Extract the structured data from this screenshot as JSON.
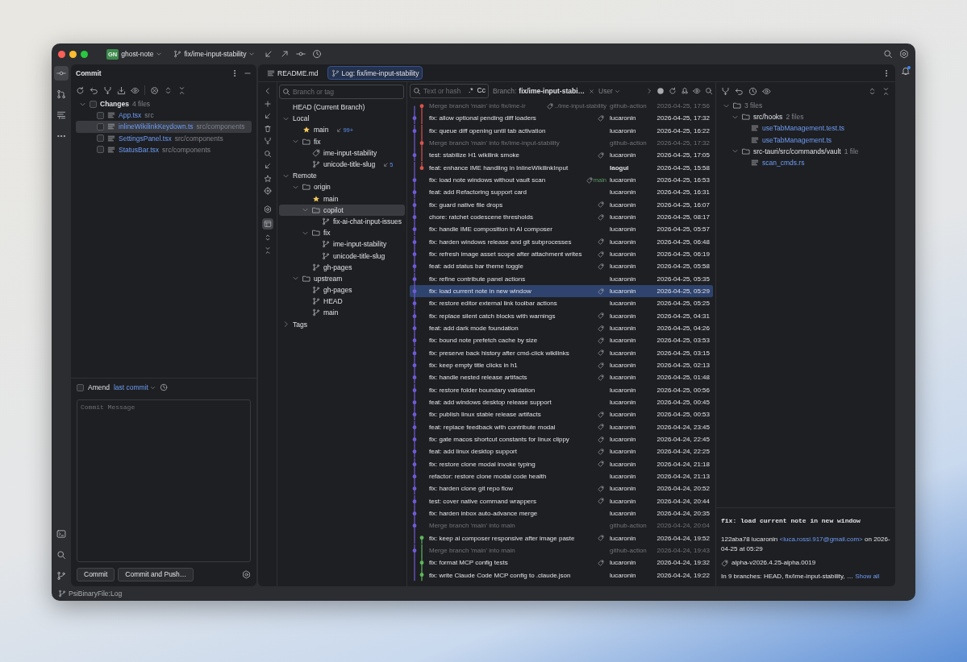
{
  "title_bar": {
    "project_badge": "GN",
    "project": "ghost-note",
    "branch": "fix/ime-input-stability"
  },
  "commit_panel": {
    "title": "Commit",
    "changes": {
      "label": "Changes",
      "count": "4 files",
      "checked": false,
      "expanded": true,
      "files": [
        {
          "name": "App.tsx",
          "path": "src",
          "checked": false,
          "selected": false
        },
        {
          "name": "inlineWikilinkKeydown.ts",
          "path": "src/components",
          "checked": false,
          "selected": true
        },
        {
          "name": "SettingsPanel.tsx",
          "path": "src/components",
          "checked": false,
          "selected": false
        },
        {
          "name": "StatusBar.tsx",
          "path": "src/components",
          "checked": false,
          "selected": false
        }
      ]
    },
    "amend": {
      "label": "Amend",
      "link": "last commit",
      "checked": false
    },
    "message": {
      "placeholder": "Commit Message"
    },
    "buttons": [
      "Commit",
      "Commit and Push…"
    ]
  },
  "editor_tabs": [
    {
      "label": "README.md",
      "kind": "file",
      "selected": false
    },
    {
      "label": "Log: fix/ime-input-stability",
      "kind": "log",
      "selected": true
    }
  ],
  "branches": {
    "search": {
      "placeholder": "Branch or tag"
    },
    "tree": [
      {
        "label": "HEAD (Current Branch)",
        "selected": false
      },
      {
        "label": "Local",
        "expanded": true,
        "selected": false,
        "children": [
          {
            "label": "main",
            "kind": "favorite",
            "badge": "99+",
            "selected": false
          },
          {
            "label": "fix",
            "kind": "folder",
            "expanded": true,
            "selected": false,
            "children": [
              {
                "label": "ime-input-stability",
                "kind": "current",
                "selected": false
              },
              {
                "label": "unicode-title-slug",
                "kind": "branch",
                "badge": "5",
                "selected": false
              }
            ]
          }
        ]
      },
      {
        "label": "Remote",
        "expanded": true,
        "selected": false,
        "children": [
          {
            "label": "origin",
            "kind": "folder",
            "expanded": true,
            "selected": false,
            "children": [
              {
                "label": "main",
                "kind": "favorite",
                "selected": false
              },
              {
                "label": "copilot",
                "kind": "folder",
                "expanded": true,
                "selected": true,
                "children": [
                  {
                    "label": "fix-ai-chat-input-issues",
                    "kind": "branch",
                    "selected": false
                  }
                ]
              },
              {
                "label": "fix",
                "kind": "folder",
                "expanded": true,
                "selected": false,
                "children": [
                  {
                    "label": "ime-input-stability",
                    "kind": "branch",
                    "selected": false
                  },
                  {
                    "label": "unicode-title-slug",
                    "kind": "branch",
                    "selected": false
                  }
                ]
              },
              {
                "label": "gh-pages",
                "kind": "branch",
                "selected": false
              }
            ]
          },
          {
            "label": "upstream",
            "kind": "folder",
            "expanded": true,
            "selected": false,
            "children": [
              {
                "label": "gh-pages",
                "kind": "branch",
                "selected": false
              },
              {
                "label": "HEAD",
                "kind": "branch",
                "selected": false
              },
              {
                "label": "main",
                "kind": "branch",
                "selected": false
              }
            ]
          }
        ]
      },
      {
        "label": "Tags",
        "expanded": false,
        "selected": false
      }
    ]
  },
  "log_filter": {
    "placeholder": "Text or hash",
    "regex": ".*",
    "match_case": "Cc",
    "branch_label": "Branch:",
    "branch_value": "fix/ime-input-stabi…",
    "user": "User"
  },
  "commits": [
    {
      "subject": "Merge branch 'main' into fix/ime-ir",
      "kind": "merge",
      "ref": "../ime-input-stability",
      "tagged": false,
      "author": "github-action",
      "date": "2026-04-25, 17:56",
      "color": "#d9534f",
      "selected": false
    },
    {
      "subject": "fix: allow optional pending diff loaders",
      "kind": "commit",
      "tagged": true,
      "author": "lucaronin",
      "date": "2026-04-25, 17:32",
      "color": "#6f5bd6",
      "selected": false
    },
    {
      "subject": "fix: queue diff opening until tab activation",
      "kind": "commit",
      "tagged": false,
      "author": "lucaronin",
      "date": "2026-04-25, 16:22",
      "color": "#6f5bd6",
      "selected": false
    },
    {
      "subject": "Merge branch 'main' into fix/ime-input-stability",
      "kind": "merge",
      "tagged": false,
      "author": "github-action",
      "date": "2026-04-25, 17:32",
      "color": "#d9534f",
      "selected": false
    },
    {
      "subject": "test: stabilize H1 wikilink smoke",
      "kind": "commit",
      "tagged": true,
      "author": "lucaronin",
      "date": "2026-04-25, 17:05",
      "color": "#6f5bd6",
      "selected": false
    },
    {
      "subject": "feat: enhance IME handling in InlineWikilinkInput",
      "kind": "commit",
      "tagged": false,
      "author": "laogui",
      "author_bold": true,
      "date": "2026-04-25, 15:58",
      "color": "#d9534f",
      "selected": false
    },
    {
      "subject": "fix: load note windows without vault scan",
      "kind": "commit",
      "ref": "main",
      "tagged": false,
      "author": "lucaronin",
      "date": "2026-04-25, 16:53",
      "color": "#6f5bd6",
      "selected": false
    },
    {
      "subject": "feat: add Refactoring support card",
      "kind": "commit",
      "tagged": false,
      "author": "lucaronin",
      "date": "2026-04-25, 16:31",
      "color": "#6f5bd6",
      "selected": false
    },
    {
      "subject": "fix: guard native file drops",
      "kind": "commit",
      "tagged": true,
      "author": "lucaronin",
      "date": "2026-04-25, 16:07",
      "color": "#6f5bd6",
      "selected": false
    },
    {
      "subject": "chore: ratchet codescene thresholds",
      "kind": "commit",
      "tagged": true,
      "author": "lucaronin",
      "date": "2026-04-25, 08:17",
      "color": "#6f5bd6",
      "selected": false
    },
    {
      "subject": "fix: handle IME composition in AI composer",
      "kind": "commit",
      "tagged": false,
      "author": "lucaronin",
      "date": "2026-04-25, 05:57",
      "color": "#6f5bd6",
      "selected": false
    },
    {
      "subject": "fix: harden windows release and git subprocesses",
      "kind": "commit",
      "tagged": true,
      "author": "lucaronin",
      "date": "2026-04-25, 06:48",
      "color": "#6f5bd6",
      "selected": false
    },
    {
      "subject": "fix: refresh image asset scope after attachment writes",
      "kind": "commit",
      "tagged": true,
      "author": "lucaronin",
      "date": "2026-04-25, 06:19",
      "color": "#6f5bd6",
      "selected": false
    },
    {
      "subject": "feat: add status bar theme toggle",
      "kind": "commit",
      "tagged": true,
      "author": "lucaronin",
      "date": "2026-04-25, 05:58",
      "color": "#6f5bd6",
      "selected": false
    },
    {
      "subject": "fix: refine contribute panel actions",
      "kind": "commit",
      "tagged": false,
      "author": "lucaronin",
      "date": "2026-04-25, 05:35",
      "color": "#6f5bd6",
      "selected": false
    },
    {
      "subject": "fix: load current note in new window",
      "kind": "commit",
      "tagged": true,
      "author": "lucaronin",
      "date": "2026-04-25, 05:29",
      "color": "#6f5bd6",
      "selected": true
    },
    {
      "subject": "fix: restore editor external link toolbar actions",
      "kind": "commit",
      "tagged": false,
      "author": "lucaronin",
      "date": "2026-04-25, 05:25",
      "color": "#6f5bd6",
      "selected": false
    },
    {
      "subject": "fix: replace silent catch blocks with warnings",
      "kind": "commit",
      "tagged": true,
      "author": "lucaronin",
      "date": "2026-04-25, 04:31",
      "color": "#6f5bd6",
      "selected": false
    },
    {
      "subject": "feat: add dark mode foundation",
      "kind": "commit",
      "tagged": true,
      "author": "lucaronin",
      "date": "2026-04-25, 04:26",
      "color": "#6f5bd6",
      "selected": false
    },
    {
      "subject": "fix: bound note prefetch cache by size",
      "kind": "commit",
      "tagged": true,
      "author": "lucaronin",
      "date": "2026-04-25, 03:53",
      "color": "#6f5bd6",
      "selected": false
    },
    {
      "subject": "fix: preserve back history after cmd-click wikilinks",
      "kind": "commit",
      "tagged": true,
      "author": "lucaronin",
      "date": "2026-04-25, 03:15",
      "color": "#6f5bd6",
      "selected": false
    },
    {
      "subject": "fix: keep empty title clicks in h1",
      "kind": "commit",
      "tagged": true,
      "author": "lucaronin",
      "date": "2026-04-25, 02:13",
      "color": "#6f5bd6",
      "selected": false
    },
    {
      "subject": "fix: handle nested release artifacts",
      "kind": "commit",
      "tagged": true,
      "author": "lucaronin",
      "date": "2026-04-25, 01:48",
      "color": "#6f5bd6",
      "selected": false
    },
    {
      "subject": "fix: restore folder boundary validation",
      "kind": "commit",
      "tagged": false,
      "author": "lucaronin",
      "date": "2026-04-25, 00:56",
      "color": "#6f5bd6",
      "selected": false
    },
    {
      "subject": "feat: add windows desktop release support",
      "kind": "commit",
      "tagged": false,
      "author": "lucaronin",
      "date": "2026-04-25, 00:45",
      "color": "#6f5bd6",
      "selected": false
    },
    {
      "subject": "fix: publish linux stable release artifacts",
      "kind": "commit",
      "tagged": true,
      "author": "lucaronin",
      "date": "2026-04-25, 00:53",
      "color": "#6f5bd6",
      "selected": false
    },
    {
      "subject": "feat: replace feedback with contribute modal",
      "kind": "commit",
      "tagged": true,
      "author": "lucaronin",
      "date": "2026-04-24, 23:45",
      "color": "#6f5bd6",
      "selected": false
    },
    {
      "subject": "fix: gate macos shortcut constants for linux clippy",
      "kind": "commit",
      "tagged": true,
      "author": "lucaronin",
      "date": "2026-04-24, 22:45",
      "color": "#6f5bd6",
      "selected": false
    },
    {
      "subject": "feat: add linux desktop support",
      "kind": "commit",
      "tagged": true,
      "author": "lucaronin",
      "date": "2026-04-24, 22:25",
      "color": "#6f5bd6",
      "selected": false
    },
    {
      "subject": "fix: restore clone modal invoke typing",
      "kind": "commit",
      "tagged": true,
      "author": "lucaronin",
      "date": "2026-04-24, 21:18",
      "color": "#6f5bd6",
      "selected": false
    },
    {
      "subject": "refactor: restore clone modal code health",
      "kind": "commit",
      "tagged": false,
      "author": "lucaronin",
      "date": "2026-04-24, 21:13",
      "color": "#6f5bd6",
      "selected": false
    },
    {
      "subject": "fix: harden clone git repo flow",
      "kind": "commit",
      "tagged": true,
      "author": "lucaronin",
      "date": "2026-04-24, 20:52",
      "color": "#6f5bd6",
      "selected": false
    },
    {
      "subject": "test: cover native command wrappers",
      "kind": "commit",
      "tagged": true,
      "author": "lucaronin",
      "date": "2026-04-24, 20:44",
      "color": "#6f5bd6",
      "selected": false
    },
    {
      "subject": "fix: harden inbox auto-advance merge",
      "kind": "commit",
      "tagged": false,
      "author": "lucaronin",
      "date": "2026-04-24, 20:35",
      "color": "#6f5bd6",
      "selected": false
    },
    {
      "subject": "Merge branch 'main' into main",
      "kind": "merge",
      "tagged": false,
      "author": "github-action",
      "date": "2026-04-24, 20:04",
      "color": "#6f5bd6",
      "selected": false
    },
    {
      "subject": "fix: keep ai composer responsive after image paste",
      "kind": "commit",
      "tagged": true,
      "author": "lucaronin",
      "date": "2026-04-24, 19:52",
      "color": "#5cb85c",
      "selected": false
    },
    {
      "subject": "Merge branch 'main' into main",
      "kind": "merge",
      "tagged": false,
      "author": "github-action",
      "date": "2026-04-24, 19:43",
      "color": "#6f5bd6",
      "selected": false
    },
    {
      "subject": "fix: format MCP config tests",
      "kind": "commit",
      "tagged": true,
      "author": "lucaronin",
      "date": "2026-04-24, 19:32",
      "color": "#5cb85c",
      "selected": false
    },
    {
      "subject": "fix: write Claude Code MCP config to .claude.json",
      "kind": "commit",
      "tagged": false,
      "author": "lucaronin",
      "date": "2026-04-24, 19:22",
      "color": "#5cb85c",
      "selected": false
    }
  ],
  "details": {
    "tree": [
      {
        "label": "3 files",
        "kind": "root",
        "expanded": true,
        "children": [
          {
            "label": "src/hooks",
            "count": "2 files",
            "kind": "folder",
            "expanded": true,
            "children": [
              {
                "label": "useTabManagement.test.ts",
                "kind": "file"
              },
              {
                "label": "useTabManagement.ts",
                "kind": "file"
              }
            ]
          },
          {
            "label": "src-tauri/src/commands/vault",
            "count": "1 file",
            "kind": "folder",
            "expanded": true,
            "children": [
              {
                "label": "scan_cmds.rs",
                "kind": "file"
              }
            ]
          }
        ]
      }
    ],
    "commit": {
      "subject": "fix: load current note in new window",
      "meta_before": "122aba78 lucaronin",
      "email": "<luca.rossi.917@gmail.com>",
      "meta_after": "on 2026-04-25 at 05:29",
      "tag": "alpha-v2026.4.25-alpha.0019",
      "branches": "In 9 branches: HEAD, fix/ime-input-stability, …",
      "show_all": "Show all"
    }
  },
  "status_bar": {
    "text": "PsiBinaryFile:Log"
  }
}
